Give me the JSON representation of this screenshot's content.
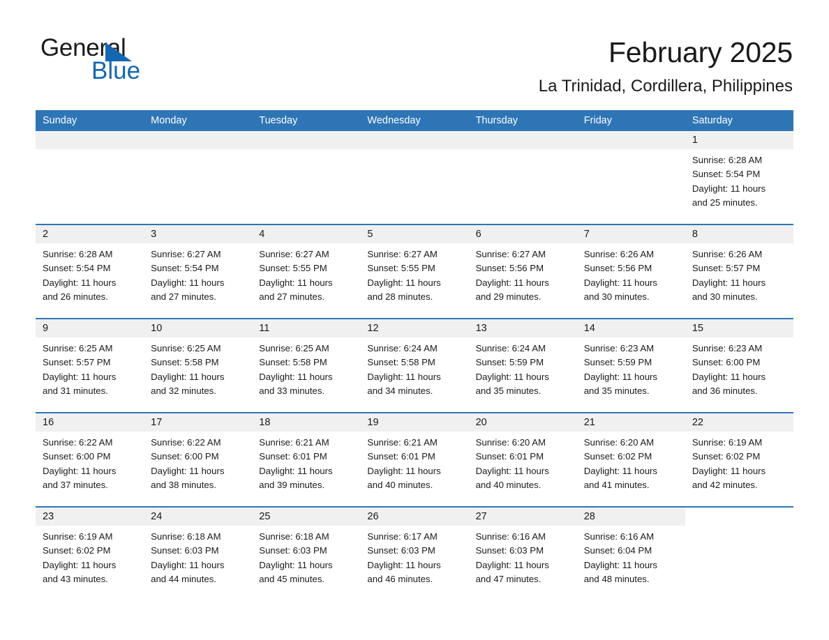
{
  "brand": {
    "name_part1": "General",
    "name_part2": "Blue",
    "triangle_icon": "triangle-icon",
    "accent_color": "#1268b3"
  },
  "header": {
    "title": "February 2025",
    "subtitle": "La Trinidad, Cordillera, Philippines"
  },
  "theme": {
    "header_row_bg": "#2e75b6",
    "day_band_bg": "#f0f0f0",
    "row_separator": "#2e75b6",
    "text": "#1a1a1a"
  },
  "weekdays": [
    "Sunday",
    "Monday",
    "Tuesday",
    "Wednesday",
    "Thursday",
    "Friday",
    "Saturday"
  ],
  "weeks": [
    [
      {
        "blank": true
      },
      {
        "blank": true
      },
      {
        "blank": true
      },
      {
        "blank": true
      },
      {
        "blank": true
      },
      {
        "blank": true
      },
      {
        "day": "1",
        "sunrise": "Sunrise: 6:28 AM",
        "sunset": "Sunset: 5:54 PM",
        "daylight_line1": "Daylight: 11 hours",
        "daylight_line2": "and 25 minutes."
      }
    ],
    [
      {
        "day": "2",
        "sunrise": "Sunrise: 6:28 AM",
        "sunset": "Sunset: 5:54 PM",
        "daylight_line1": "Daylight: 11 hours",
        "daylight_line2": "and 26 minutes."
      },
      {
        "day": "3",
        "sunrise": "Sunrise: 6:27 AM",
        "sunset": "Sunset: 5:54 PM",
        "daylight_line1": "Daylight: 11 hours",
        "daylight_line2": "and 27 minutes."
      },
      {
        "day": "4",
        "sunrise": "Sunrise: 6:27 AM",
        "sunset": "Sunset: 5:55 PM",
        "daylight_line1": "Daylight: 11 hours",
        "daylight_line2": "and 27 minutes."
      },
      {
        "day": "5",
        "sunrise": "Sunrise: 6:27 AM",
        "sunset": "Sunset: 5:55 PM",
        "daylight_line1": "Daylight: 11 hours",
        "daylight_line2": "and 28 minutes."
      },
      {
        "day": "6",
        "sunrise": "Sunrise: 6:27 AM",
        "sunset": "Sunset: 5:56 PM",
        "daylight_line1": "Daylight: 11 hours",
        "daylight_line2": "and 29 minutes."
      },
      {
        "day": "7",
        "sunrise": "Sunrise: 6:26 AM",
        "sunset": "Sunset: 5:56 PM",
        "daylight_line1": "Daylight: 11 hours",
        "daylight_line2": "and 30 minutes."
      },
      {
        "day": "8",
        "sunrise": "Sunrise: 6:26 AM",
        "sunset": "Sunset: 5:57 PM",
        "daylight_line1": "Daylight: 11 hours",
        "daylight_line2": "and 30 minutes."
      }
    ],
    [
      {
        "day": "9",
        "sunrise": "Sunrise: 6:25 AM",
        "sunset": "Sunset: 5:57 PM",
        "daylight_line1": "Daylight: 11 hours",
        "daylight_line2": "and 31 minutes."
      },
      {
        "day": "10",
        "sunrise": "Sunrise: 6:25 AM",
        "sunset": "Sunset: 5:58 PM",
        "daylight_line1": "Daylight: 11 hours",
        "daylight_line2": "and 32 minutes."
      },
      {
        "day": "11",
        "sunrise": "Sunrise: 6:25 AM",
        "sunset": "Sunset: 5:58 PM",
        "daylight_line1": "Daylight: 11 hours",
        "daylight_line2": "and 33 minutes."
      },
      {
        "day": "12",
        "sunrise": "Sunrise: 6:24 AM",
        "sunset": "Sunset: 5:58 PM",
        "daylight_line1": "Daylight: 11 hours",
        "daylight_line2": "and 34 minutes."
      },
      {
        "day": "13",
        "sunrise": "Sunrise: 6:24 AM",
        "sunset": "Sunset: 5:59 PM",
        "daylight_line1": "Daylight: 11 hours",
        "daylight_line2": "and 35 minutes."
      },
      {
        "day": "14",
        "sunrise": "Sunrise: 6:23 AM",
        "sunset": "Sunset: 5:59 PM",
        "daylight_line1": "Daylight: 11 hours",
        "daylight_line2": "and 35 minutes."
      },
      {
        "day": "15",
        "sunrise": "Sunrise: 6:23 AM",
        "sunset": "Sunset: 6:00 PM",
        "daylight_line1": "Daylight: 11 hours",
        "daylight_line2": "and 36 minutes."
      }
    ],
    [
      {
        "day": "16",
        "sunrise": "Sunrise: 6:22 AM",
        "sunset": "Sunset: 6:00 PM",
        "daylight_line1": "Daylight: 11 hours",
        "daylight_line2": "and 37 minutes."
      },
      {
        "day": "17",
        "sunrise": "Sunrise: 6:22 AM",
        "sunset": "Sunset: 6:00 PM",
        "daylight_line1": "Daylight: 11 hours",
        "daylight_line2": "and 38 minutes."
      },
      {
        "day": "18",
        "sunrise": "Sunrise: 6:21 AM",
        "sunset": "Sunset: 6:01 PM",
        "daylight_line1": "Daylight: 11 hours",
        "daylight_line2": "and 39 minutes."
      },
      {
        "day": "19",
        "sunrise": "Sunrise: 6:21 AM",
        "sunset": "Sunset: 6:01 PM",
        "daylight_line1": "Daylight: 11 hours",
        "daylight_line2": "and 40 minutes."
      },
      {
        "day": "20",
        "sunrise": "Sunrise: 6:20 AM",
        "sunset": "Sunset: 6:01 PM",
        "daylight_line1": "Daylight: 11 hours",
        "daylight_line2": "and 40 minutes."
      },
      {
        "day": "21",
        "sunrise": "Sunrise: 6:20 AM",
        "sunset": "Sunset: 6:02 PM",
        "daylight_line1": "Daylight: 11 hours",
        "daylight_line2": "and 41 minutes."
      },
      {
        "day": "22",
        "sunrise": "Sunrise: 6:19 AM",
        "sunset": "Sunset: 6:02 PM",
        "daylight_line1": "Daylight: 11 hours",
        "daylight_line2": "and 42 minutes."
      }
    ],
    [
      {
        "day": "23",
        "sunrise": "Sunrise: 6:19 AM",
        "sunset": "Sunset: 6:02 PM",
        "daylight_line1": "Daylight: 11 hours",
        "daylight_line2": "and 43 minutes."
      },
      {
        "day": "24",
        "sunrise": "Sunrise: 6:18 AM",
        "sunset": "Sunset: 6:03 PM",
        "daylight_line1": "Daylight: 11 hours",
        "daylight_line2": "and 44 minutes."
      },
      {
        "day": "25",
        "sunrise": "Sunrise: 6:18 AM",
        "sunset": "Sunset: 6:03 PM",
        "daylight_line1": "Daylight: 11 hours",
        "daylight_line2": "and 45 minutes."
      },
      {
        "day": "26",
        "sunrise": "Sunrise: 6:17 AM",
        "sunset": "Sunset: 6:03 PM",
        "daylight_line1": "Daylight: 11 hours",
        "daylight_line2": "and 46 minutes."
      },
      {
        "day": "27",
        "sunrise": "Sunrise: 6:16 AM",
        "sunset": "Sunset: 6:03 PM",
        "daylight_line1": "Daylight: 11 hours",
        "daylight_line2": "and 47 minutes."
      },
      {
        "day": "28",
        "sunrise": "Sunrise: 6:16 AM",
        "sunset": "Sunset: 6:04 PM",
        "daylight_line1": "Daylight: 11 hours",
        "daylight_line2": "and 48 minutes."
      },
      {
        "blank": true
      }
    ]
  ]
}
